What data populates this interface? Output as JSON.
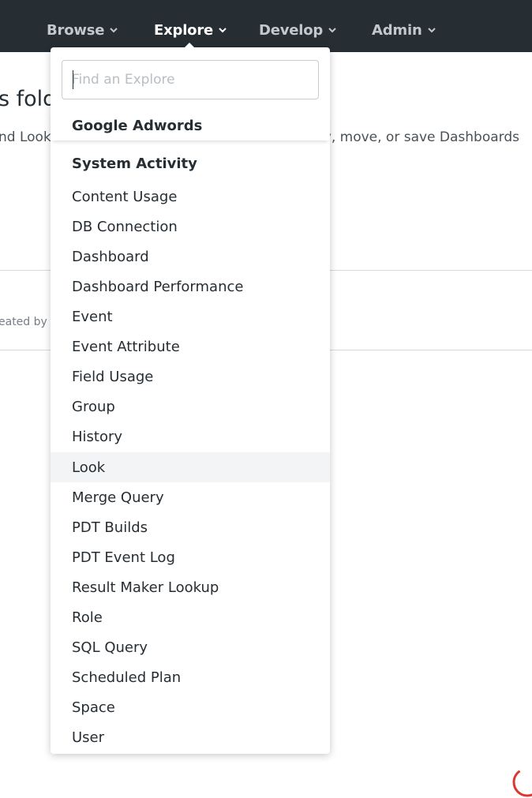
{
  "topnav": {
    "items": [
      {
        "label": "Browse",
        "active": false
      },
      {
        "label": "Explore",
        "active": true
      },
      {
        "label": "Develop",
        "active": false
      },
      {
        "label": "Admin",
        "active": false
      }
    ]
  },
  "page": {
    "title_fragment": "s fold",
    "description_left": "nd Look",
    "description_right": "by, move, or save Dashboards",
    "meta_fragment": "eated by"
  },
  "explore_menu": {
    "search_placeholder": "Find an Explore",
    "groups": [
      {
        "label": "Google Adwords"
      },
      {
        "label": "System Activity",
        "items": [
          "Content Usage",
          "DB Connection",
          "Dashboard",
          "Dashboard Performance",
          "Event",
          "Event Attribute",
          "Field Usage",
          "Group",
          "History",
          "Look",
          "Merge Query",
          "PDT Builds",
          "PDT Event Log",
          "Result Maker Lookup",
          "Role",
          "SQL Query",
          "Scheduled Plan",
          "Space",
          "User"
        ]
      }
    ],
    "hovered_item": "Look"
  },
  "colors": {
    "nav_bg": "#262d33",
    "hover_bg": "#f3f4f5",
    "spinner": "#e0342e"
  }
}
